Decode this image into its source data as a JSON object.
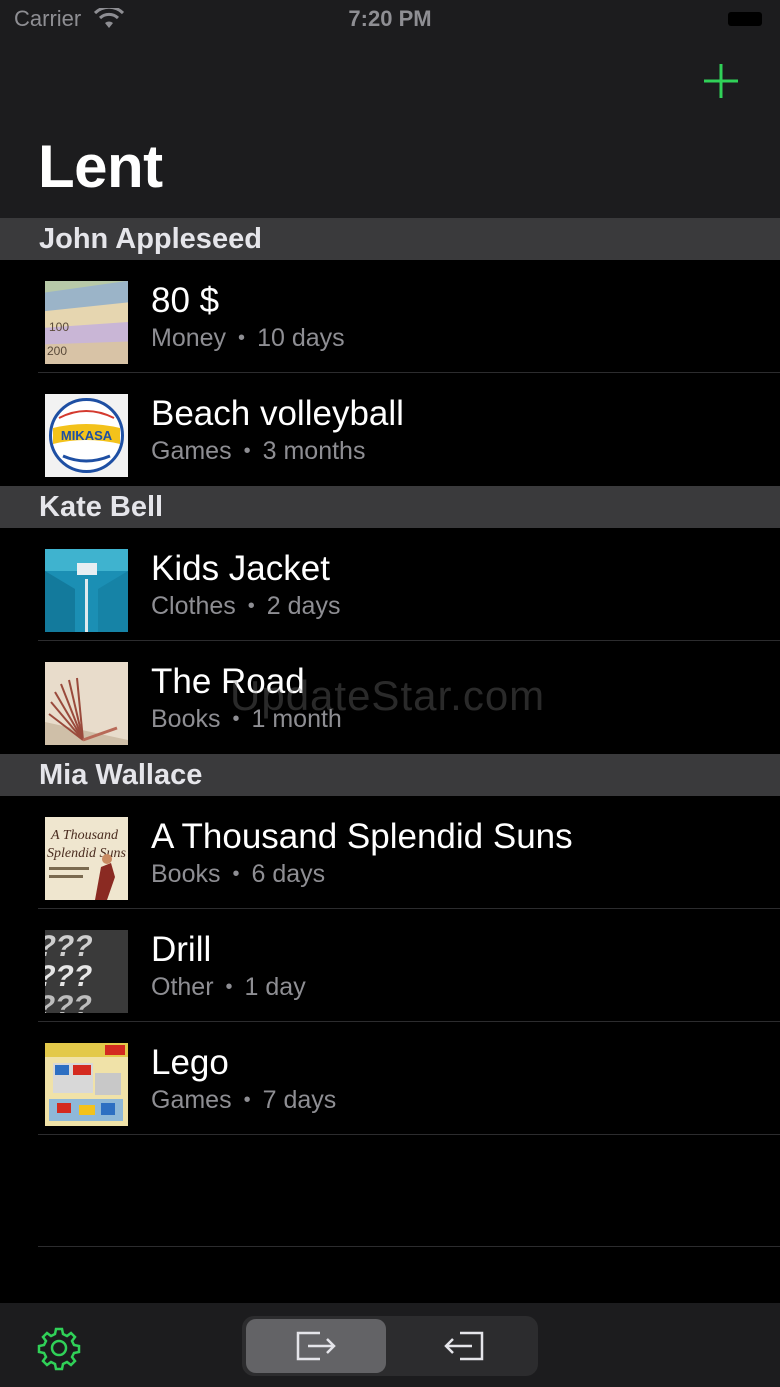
{
  "status_bar": {
    "carrier": "Carrier",
    "time": "7:20 PM"
  },
  "header": {
    "title": "Lent",
    "add_icon": "plus-icon",
    "accent_color": "#30d158"
  },
  "sections": [
    {
      "name": "John Appleseed",
      "items": [
        {
          "title": "80 $",
          "category": "Money",
          "duration": "10 days",
          "thumb": "money"
        },
        {
          "title": "Beach volleyball",
          "category": "Games",
          "duration": "3 months",
          "thumb": "volleyball"
        }
      ]
    },
    {
      "name": "Kate Bell",
      "items": [
        {
          "title": "Kids Jacket",
          "category": "Clothes",
          "duration": "2 days",
          "thumb": "jacket"
        },
        {
          "title": "The Road",
          "category": "Books",
          "duration": "1 month",
          "thumb": "book"
        }
      ]
    },
    {
      "name": "Mia Wallace",
      "items": [
        {
          "title": "A Thousand Splendid Suns",
          "category": "Books",
          "duration": "6 days",
          "thumb": "novel"
        },
        {
          "title": "Drill",
          "category": "Other",
          "duration": "1 day",
          "thumb": "question"
        },
        {
          "title": "Lego",
          "category": "Games",
          "duration": "7 days",
          "thumb": "lego"
        }
      ]
    }
  ],
  "thumb_text": {
    "volleyball_brand": "MIKASA",
    "novel_line1": "A Thousand",
    "novel_line2": "Splendid Suns"
  },
  "watermark": "UpdateStar.com",
  "toolbar": {
    "settings_icon": "gear-icon",
    "segments": [
      {
        "icon": "lent-out-icon",
        "selected": true
      },
      {
        "icon": "borrowed-in-icon",
        "selected": false
      }
    ]
  }
}
